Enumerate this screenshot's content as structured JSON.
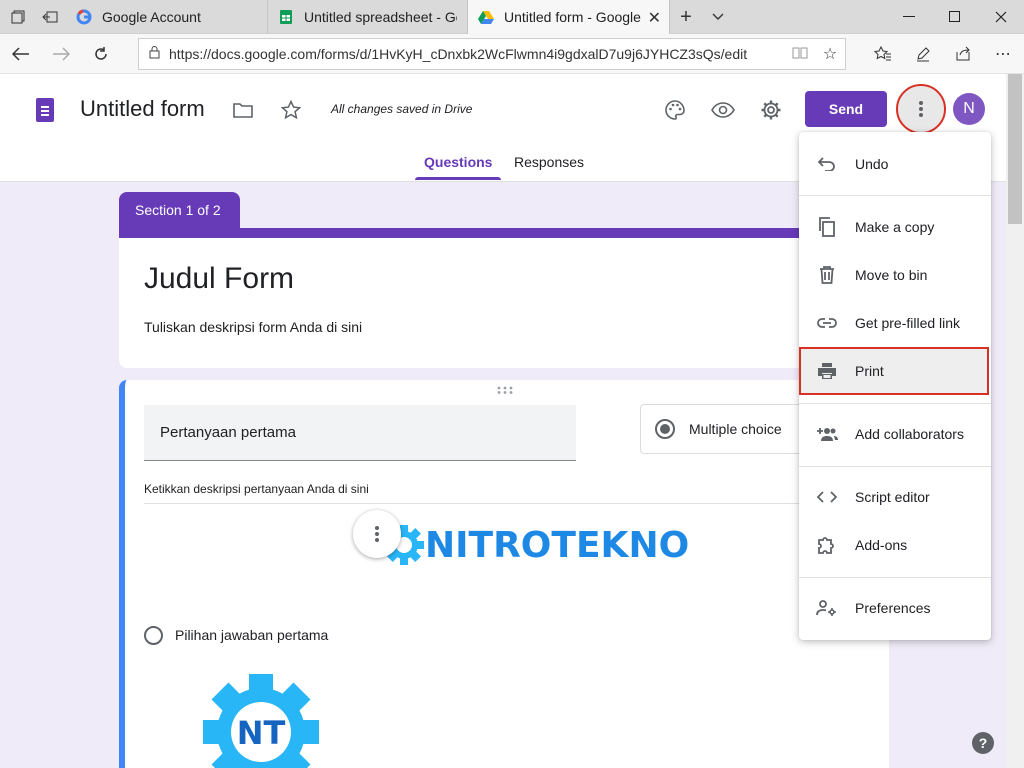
{
  "browser": {
    "tabs": [
      {
        "label": "Google Account",
        "active": false
      },
      {
        "label": "Untitled spreadsheet - Goog",
        "active": false
      },
      {
        "label": "Untitled form - Google",
        "active": true
      }
    ],
    "new_tab_symbol": "+",
    "url": "https://docs.google.com/forms/d/1HvKyH_cDnxbk2WcFlwmn4i9gdxalD7u9j6JYHCZ3sQs/edit"
  },
  "header": {
    "title": "Untitled form",
    "saved_status": "All changes saved in Drive",
    "send_label": "Send",
    "avatar_initial": "N",
    "tabs": {
      "questions": "Questions",
      "responses": "Responses"
    }
  },
  "form": {
    "section_label": "Section 1 of 2",
    "heading": "Judul Form",
    "description": "Tuliskan deskripsi form Anda di sini",
    "question": {
      "title": "Pertanyaan pertama",
      "type": "Multiple choice",
      "description": "Ketikkan deskripsi pertanyaan Anda di sini",
      "image_text": "NITROTEKNO",
      "option_label": "Pilihan jawaban pertama",
      "option_image_text": "NT"
    }
  },
  "menu": {
    "items": [
      {
        "label": "Undo",
        "icon": "undo-icon"
      },
      {
        "label": "Make a copy",
        "icon": "copy-icon"
      },
      {
        "label": "Move to bin",
        "icon": "trash-icon"
      },
      {
        "label": "Get pre-filled link",
        "icon": "link-icon"
      },
      {
        "label": "Print",
        "icon": "print-icon",
        "highlighted": true
      },
      {
        "label": "Add collaborators",
        "icon": "add-people-icon"
      },
      {
        "label": "Script editor",
        "icon": "code-icon"
      },
      {
        "label": "Add-ons",
        "icon": "puzzle-icon"
      },
      {
        "label": "Preferences",
        "icon": "person-settings-icon"
      }
    ]
  },
  "colors": {
    "brand": "#673ab7",
    "question_accent": "#4285f4",
    "canvas": "#f0ebf8",
    "highlight_outline": "#d93025",
    "logo_blue": "#1e88e5"
  }
}
